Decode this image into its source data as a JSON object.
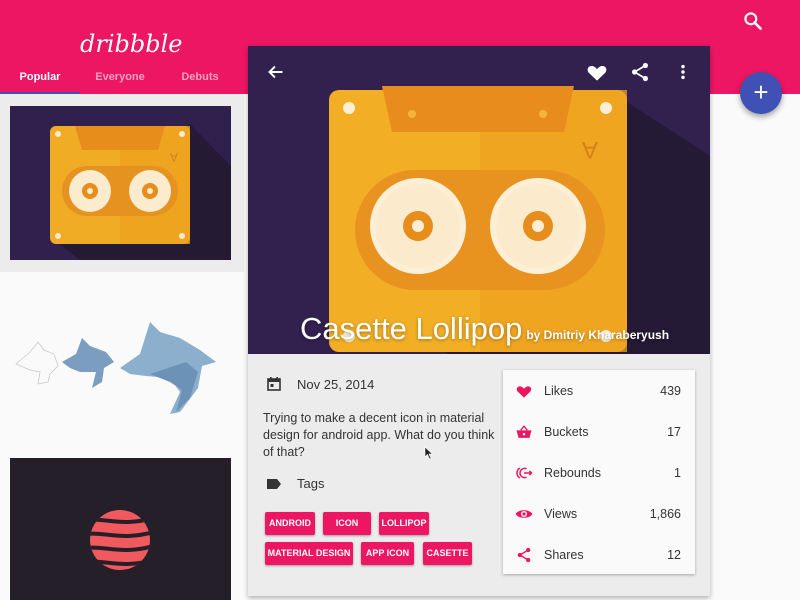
{
  "app": {
    "logo": "dribbble",
    "tabs": [
      {
        "label": "Popular",
        "active": true
      },
      {
        "label": "Everyone",
        "active": false
      },
      {
        "label": "Debuts",
        "active": false
      }
    ],
    "search_icon": "search-icon",
    "fab_label": "+",
    "colors": {
      "primary": "#ec1662",
      "accent": "#3f51b5",
      "hero_bg": "#32214f"
    }
  },
  "feed": {
    "shots": [
      {
        "title": "Casette Lollipop thumbnail"
      },
      {
        "title": "Wolf icon thumbnail"
      },
      {
        "title": "Striped sphere thumbnail"
      }
    ]
  },
  "detail": {
    "toolbar": {
      "back_icon": "arrow-back-icon",
      "like_icon": "heart-icon",
      "share_icon": "share-icon",
      "more_icon": "more-vert-icon"
    },
    "title": "Casette Lollipop",
    "author": "by Dmitriy Kharaberyush",
    "date": "Nov 25, 2014",
    "description": "Trying to make a decent icon in material design for android app. What do you think of that?",
    "tags_label": "Tags",
    "tags": [
      "ANDROID",
      "ICON",
      "LOLLIPOP",
      "MATERIAL DESIGN",
      "APP ICON",
      "CASETTE"
    ],
    "stats": [
      {
        "label": "Likes",
        "value": "439",
        "icon": "heart-icon"
      },
      {
        "label": "Buckets",
        "value": "17",
        "icon": "basket-icon"
      },
      {
        "label": "Rebounds",
        "value": "1",
        "icon": "rebound-icon"
      },
      {
        "label": "Views",
        "value": "1,866",
        "icon": "eye-icon"
      },
      {
        "label": "Shares",
        "value": "12",
        "icon": "share-icon"
      }
    ]
  }
}
